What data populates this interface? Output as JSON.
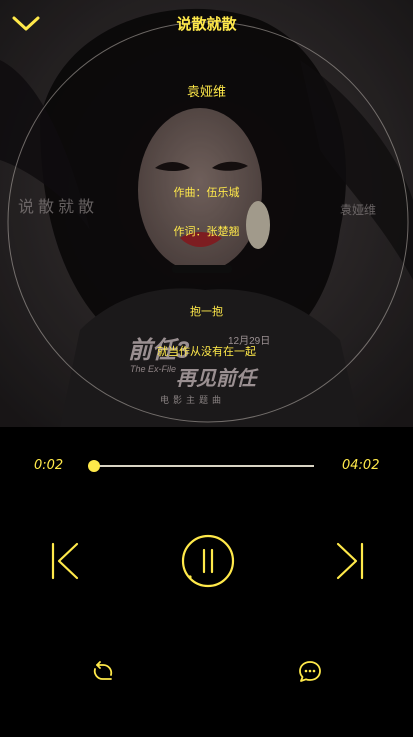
{
  "header": {
    "title": "说散就散"
  },
  "cover_art": {
    "watermark_left": "说散就散",
    "watermark_right": "袁娅维",
    "poster_title_line1": "前任3",
    "poster_title_line2": "再见前任",
    "poster_date": "12月29日",
    "poster_subtitle": "The Ex-File",
    "poster_caption": "电影主题曲"
  },
  "lyrics": {
    "singer": "袁娅维",
    "composer": "作曲：伍乐城",
    "lyricist": "作词：张楚翘",
    "line1": "抱一抱",
    "line2": "就当作从没有在一起"
  },
  "player": {
    "current_time": "0:02",
    "total_time": "04:02",
    "progress_fraction": 0.0083,
    "state": "playing"
  },
  "icons": {
    "back": "chevron-down-icon",
    "prev": "skip-previous-icon",
    "pause": "pause-icon",
    "next": "skip-next-icon",
    "repeat": "repeat-icon",
    "comment": "comment-icon"
  },
  "colors": {
    "accent": "#ffe94a",
    "background": "#000000"
  }
}
